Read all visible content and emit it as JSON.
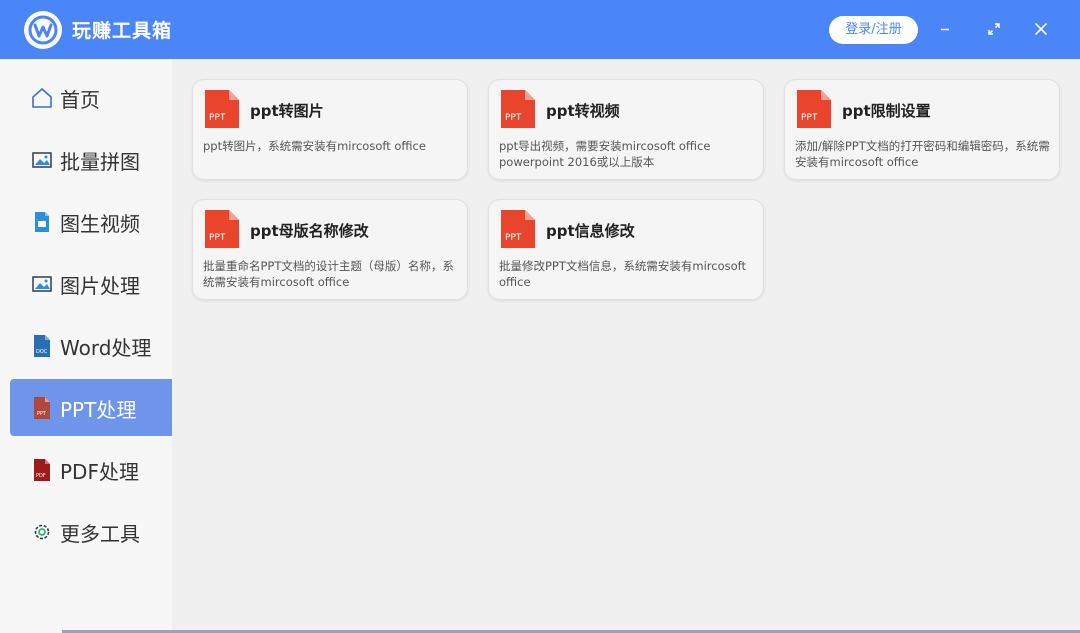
{
  "app": {
    "title": "玩赚工具箱",
    "login_label": "登录/注册"
  },
  "colors": {
    "brand": "#4a86f7",
    "active_nav": "#6e95ea",
    "ppt_red": "#e8452c"
  },
  "sidebar": {
    "items": [
      {
        "label": "首页",
        "icon": "home-icon",
        "active": false
      },
      {
        "label": "批量拼图",
        "icon": "image-icon",
        "active": false
      },
      {
        "label": "图生视频",
        "icon": "video-file-icon",
        "active": false
      },
      {
        "label": "图片处理",
        "icon": "image-icon",
        "active": false
      },
      {
        "label": "Word处理",
        "icon": "doc-file-icon",
        "active": false
      },
      {
        "label": "PPT处理",
        "icon": "ppt-file-icon",
        "active": true
      },
      {
        "label": "PDF处理",
        "icon": "pdf-file-icon",
        "active": false
      },
      {
        "label": "更多工具",
        "icon": "gear-icon",
        "active": false
      }
    ]
  },
  "cards": [
    {
      "title": "ppt转图片",
      "desc": "ppt转图片，系统需安装有mircosoft office",
      "icon": "ppt-file-icon",
      "icon_text": "PPT"
    },
    {
      "title": "ppt转视频",
      "desc": "ppt导出视频，需要安装mircosoft office powerpoint 2016或以上版本",
      "icon": "ppt-file-icon",
      "icon_text": "PPT"
    },
    {
      "title": "ppt限制设置",
      "desc": "添加/解除PPT文档的打开密码和编辑密码，系统需安装有mircosoft office",
      "icon": "ppt-file-icon",
      "icon_text": "PPT"
    },
    {
      "title": "ppt母版名称修改",
      "desc": "批量重命名PPT文档的设计主题（母版）名称，系统需安装有mircosoft office",
      "icon": "ppt-file-icon",
      "icon_text": "PPT"
    },
    {
      "title": "ppt信息修改",
      "desc": "批量修改PPT文档信息，系统需安装有mircosoft office",
      "icon": "ppt-file-icon",
      "icon_text": "PPT"
    }
  ]
}
